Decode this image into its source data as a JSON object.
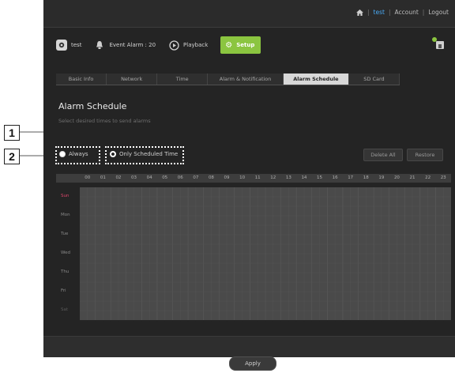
{
  "header": {
    "user_link": "test",
    "account_link": "Account",
    "logout_link": "Logout",
    "sep": "|"
  },
  "nav": {
    "camera_label": "test",
    "event_alarm_label": "Event Alarm : 20",
    "playback_label": "Playback",
    "setup_label": "Setup"
  },
  "tabs": [
    "Basic Info",
    "Network",
    "Time",
    "Alarm & Notification",
    "Alarm Schedule",
    "SD Card"
  ],
  "active_tab": "Alarm Schedule",
  "page": {
    "title": "Alarm Schedule",
    "subtitle": "Select desired times to send alarms"
  },
  "options": {
    "always": "Always",
    "scheduled": "Only Scheduled Time"
  },
  "actions": {
    "delete_all": "Delete All",
    "restore": "Restore",
    "apply": "Apply"
  },
  "hours": [
    "00",
    "01",
    "02",
    "03",
    "04",
    "05",
    "06",
    "07",
    "08",
    "09",
    "10",
    "11",
    "12",
    "13",
    "14",
    "15",
    "16",
    "17",
    "18",
    "19",
    "20",
    "21",
    "22",
    "23"
  ],
  "days": [
    "Sun",
    "Mon",
    "Tue",
    "Wed",
    "Thu",
    "Fri",
    "Sat"
  ],
  "callouts": [
    "1",
    "2"
  ],
  "colors": {
    "accent_green": "#8bc540",
    "user_link": "#49a8f2",
    "sunday": "#e0466c",
    "grid_cell": "#4a4a4a"
  }
}
